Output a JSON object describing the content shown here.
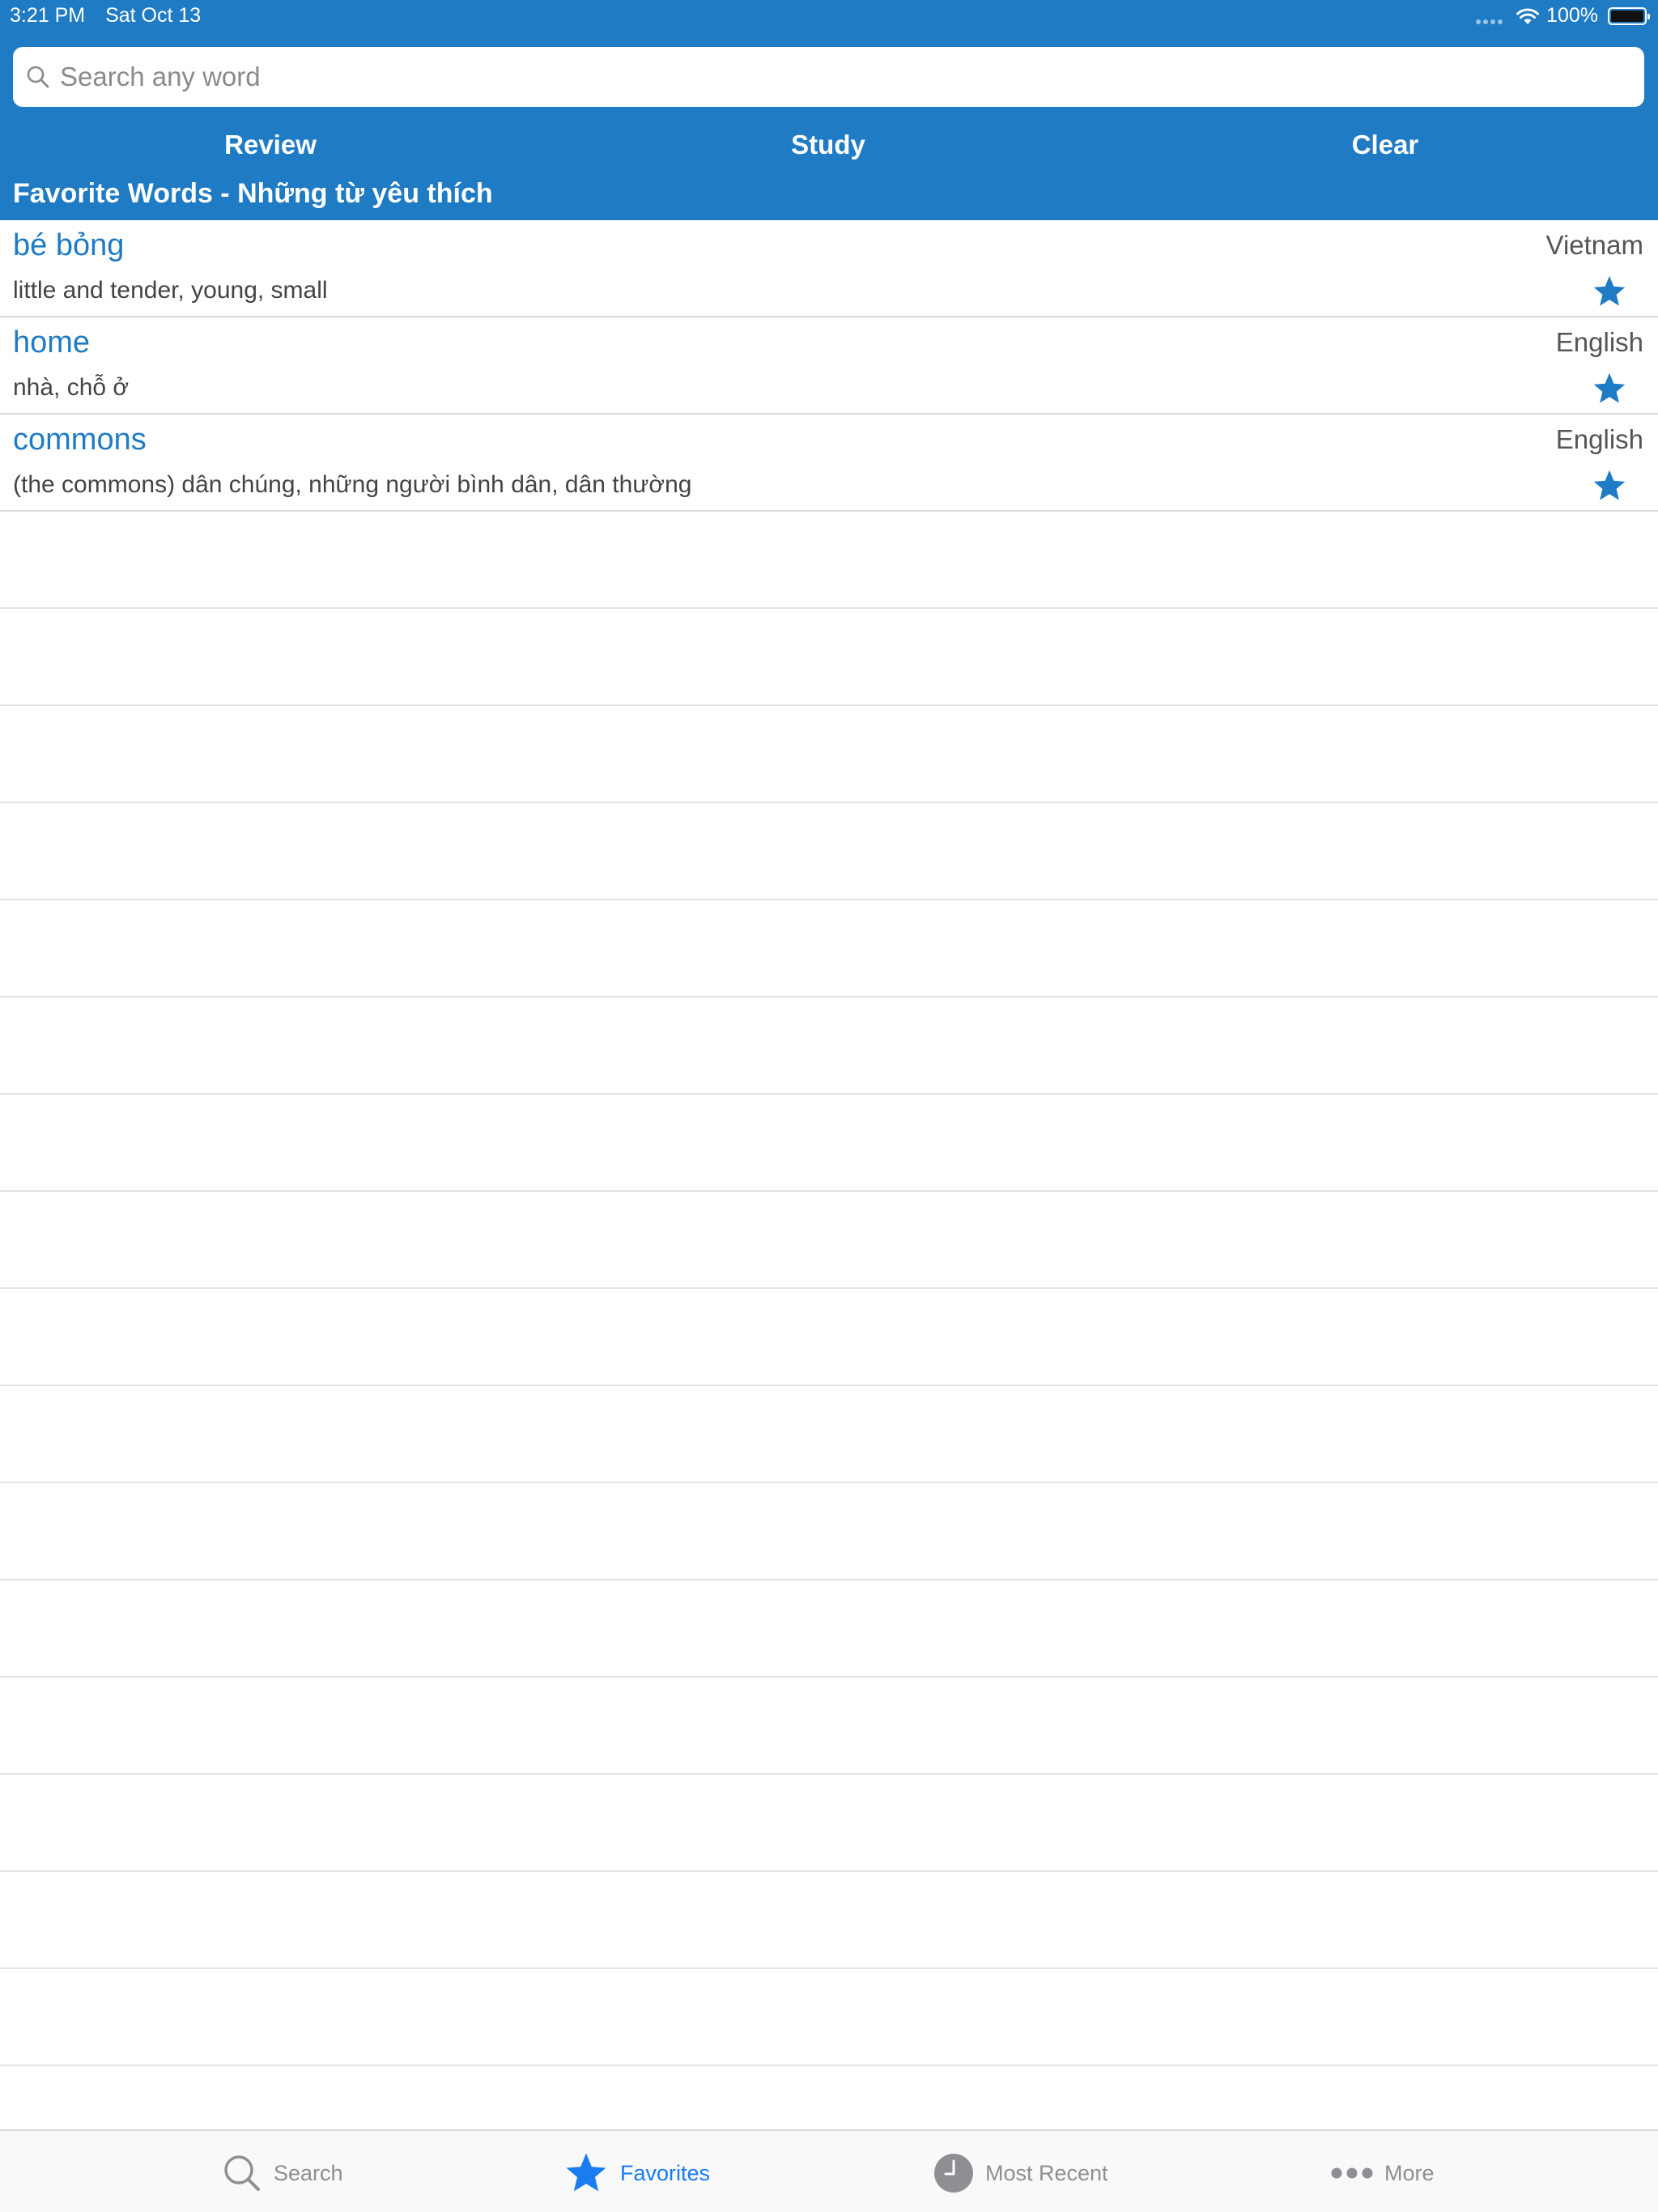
{
  "status_bar": {
    "time": "3:21 PM",
    "date": "Sat Oct 13",
    "battery": "100%",
    "wifi_icon": "wifi-icon",
    "battery_icon": "battery-icon"
  },
  "search": {
    "placeholder": "Search any word",
    "value": "",
    "icon": "search-icon"
  },
  "actions": {
    "review_label": "Review",
    "study_label": "Study",
    "clear_label": "Clear"
  },
  "section_title": "Favorite Words - Những từ yêu thích",
  "favorites": [
    {
      "word": "bé bỏng",
      "language": "Vietnam",
      "meaning": "little and tender, young, small",
      "icon": "star-icon"
    },
    {
      "word": "home",
      "language": "English",
      "meaning": "nhà, chỗ ở",
      "icon": "star-icon"
    },
    {
      "word": "commons",
      "language": "English",
      "meaning": "(the commons) dân chúng, những người bình dân, dân thường",
      "icon": "star-icon"
    }
  ],
  "tabs": [
    {
      "label": "Search",
      "icon": "search-icon",
      "active": false
    },
    {
      "label": "Favorites",
      "icon": "star-icon",
      "active": true
    },
    {
      "label": "Most Recent",
      "icon": "clock-icon",
      "active": false
    },
    {
      "label": "More",
      "icon": "more-icon",
      "active": false
    }
  ],
  "colors": {
    "brand": "#1f7bc4",
    "active_tab": "#1a7cf0",
    "inactive_tab": "#8e8e93"
  }
}
